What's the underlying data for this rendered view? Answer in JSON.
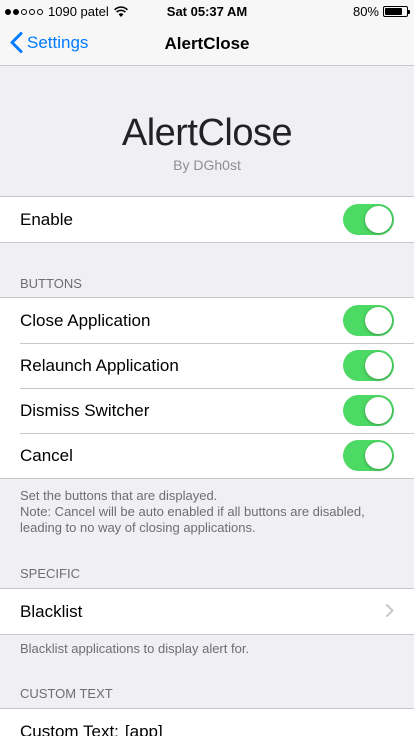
{
  "status_bar": {
    "carrier": "1090 patel",
    "time": "Sat 05:37 AM",
    "battery": "80%",
    "battery_level": 0.8,
    "signal_bars": 2
  },
  "nav": {
    "back_label": "Settings",
    "title": "AlertClose"
  },
  "header": {
    "title": "AlertClose",
    "subtitle": "By DGh0st"
  },
  "enable": {
    "label": "Enable",
    "on": true
  },
  "buttons_section": {
    "header": "BUTTONS",
    "items": [
      {
        "label": "Close Application",
        "on": true
      },
      {
        "label": "Relaunch Application",
        "on": true
      },
      {
        "label": "Dismiss Switcher",
        "on": true
      },
      {
        "label": "Cancel",
        "on": true
      }
    ],
    "footer_line1": "Set the buttons that are displayed.",
    "footer_line2": "Note: Cancel will be auto enabled if all buttons are disabled, leading to no way of closing applications."
  },
  "specific_section": {
    "header": "SPECIFIC",
    "blacklist_label": "Blacklist",
    "footer": "Blacklist applications to display alert for."
  },
  "custom_text_section": {
    "header": "CUSTOM TEXT",
    "item_label": "Custom Text:",
    "item_value": "[app]"
  },
  "colors": {
    "accent": "#007aff",
    "toggle_on": "#4cd964",
    "background": "#efeff4"
  }
}
